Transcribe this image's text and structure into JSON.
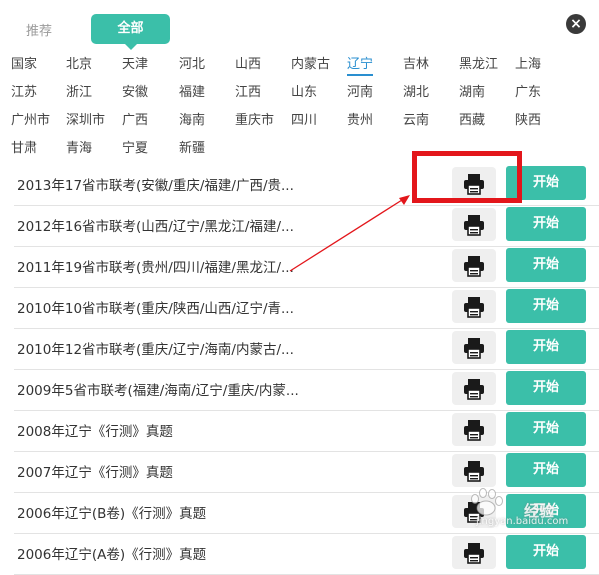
{
  "tabs": {
    "recommended": "推荐",
    "all": "全部"
  },
  "close_label": "×",
  "regions": [
    "国家",
    "北京",
    "天津",
    "河北",
    "山西",
    "内蒙古",
    "辽宁",
    "吉林",
    "黑龙江",
    "上海",
    "江苏",
    "浙江",
    "安徽",
    "福建",
    "江西",
    "山东",
    "河南",
    "湖北",
    "湖南",
    "广东",
    "广州市",
    "深圳市",
    "广西",
    "海南",
    "重庆市",
    "四川",
    "贵州",
    "云南",
    "西藏",
    "陕西",
    "甘肃",
    "青海",
    "宁夏",
    "新疆"
  ],
  "active_region": "辽宁",
  "rows": [
    {
      "title": "2013年17省市联考(安徽/重庆/福建/广西/贵...",
      "button": "开始"
    },
    {
      "title": "2012年16省市联考(山西/辽宁/黑龙江/福建/...",
      "button": "开始"
    },
    {
      "title": "2011年19省市联考(贵州/四川/福建/黑龙江/...",
      "button": "开始"
    },
    {
      "title": "2010年10省市联考(重庆/陕西/山西/辽宁/青...",
      "button": "开始"
    },
    {
      "title": "2010年12省市联考(重庆/辽宁/海南/内蒙古/...",
      "button": "开始"
    },
    {
      "title": "2009年5省市联考(福建/海南/辽宁/重庆/内蒙...",
      "button": "开始"
    },
    {
      "title": "2008年辽宁《行测》真题",
      "button": "开始"
    },
    {
      "title": "2007年辽宁《行测》真题",
      "button": "开始"
    },
    {
      "title": "2006年辽宁(B卷)《行测》真题",
      "button": "开始"
    },
    {
      "title": "2006年辽宁(A卷)《行测》真题",
      "button": "开始"
    }
  ],
  "icons": {
    "print": "printer-icon",
    "close": "close-icon"
  },
  "colors": {
    "accent": "#3bbfa9",
    "highlight": "#e3161b",
    "active_link": "#2a8fd0"
  },
  "watermark": {
    "brand": "经验",
    "sub": "jingyan.baidu.com"
  }
}
